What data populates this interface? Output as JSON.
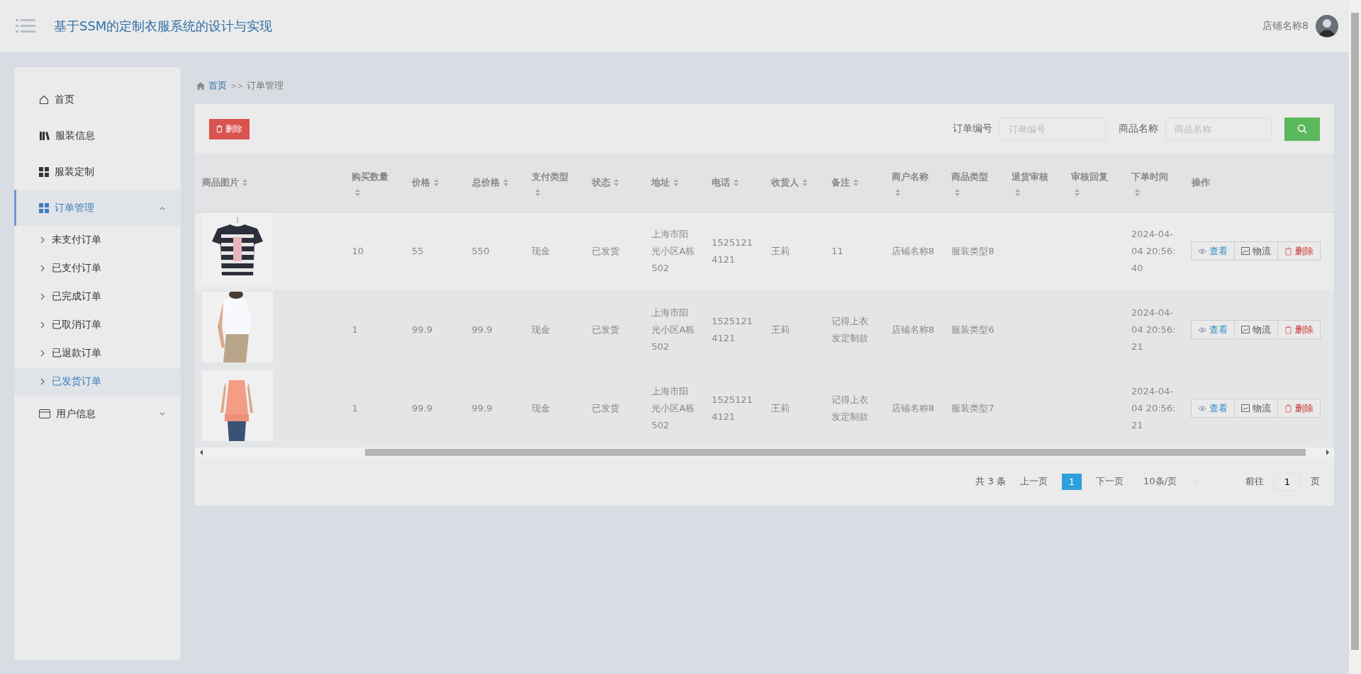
{
  "header": {
    "title": "基于SSM的定制衣服系统的设计与实现",
    "user": "店铺名称8"
  },
  "sidebar": {
    "items": [
      {
        "label": "首页",
        "selected": false
      },
      {
        "label": "服装信息",
        "selected": false
      },
      {
        "label": "服装定制",
        "selected": false
      },
      {
        "label": "订单管理",
        "expanded": true,
        "selected": true,
        "children": [
          {
            "label": "未支付订单",
            "selected": false
          },
          {
            "label": "已支付订单",
            "selected": false
          },
          {
            "label": "已完成订单",
            "selected": false
          },
          {
            "label": "已取消订单",
            "selected": false
          },
          {
            "label": "已退款订单",
            "selected": false
          },
          {
            "label": "已发货订单",
            "selected": true
          }
        ]
      },
      {
        "label": "用户信息",
        "expanded": false,
        "selected": false
      }
    ]
  },
  "breadcrumb": {
    "home": "首页",
    "separator": ">>",
    "current": "订单管理"
  },
  "toolbar": {
    "delete_button": "删除",
    "filters": [
      {
        "label": "订单编号",
        "placeholder": "订单编号"
      },
      {
        "label": "商品名称",
        "placeholder": "商品名称"
      }
    ]
  },
  "table": {
    "columns": [
      {
        "label": "商品图片",
        "sortable": true
      },
      {
        "label": "购买数量",
        "sortable": true
      },
      {
        "label": "价格",
        "sortable": true
      },
      {
        "label": "总价格",
        "sortable": true
      },
      {
        "label": "支付类型",
        "sortable": true
      },
      {
        "label": "状态",
        "sortable": true
      },
      {
        "label": "地址",
        "sortable": true
      },
      {
        "label": "电话",
        "sortable": true
      },
      {
        "label": "收货人",
        "sortable": true
      },
      {
        "label": "备注",
        "sortable": true
      },
      {
        "label": "商户名称",
        "sortable": true
      },
      {
        "label": "商品类型",
        "sortable": true
      },
      {
        "label": "退货审核",
        "sortable": true
      },
      {
        "label": "审核回复",
        "sortable": true
      },
      {
        "label": "下单时间",
        "sortable": true
      },
      {
        "label": "操作",
        "sortable": false
      }
    ],
    "rows": [
      {
        "cells": [
          {
            "kind": "picture"
          },
          "10",
          "55",
          "550",
          "现金",
          "已发货",
          "上海市阳光小区A栋502",
          "15251214121",
          "王莉",
          "11",
          "店铺名称8",
          "服装类型8",
          "",
          "",
          "2024-04-04 20:56:40",
          {
            "kind": "actions",
            "buttons": [
              {
                "kind": "view",
                "label": "查看"
              },
              {
                "kind": "logistics",
                "label": "物流"
              },
              {
                "kind": "delete",
                "label": "删除"
              }
            ]
          }
        ]
      },
      {
        "cells": [
          {
            "kind": "picture"
          },
          "1",
          "99.9",
          "99.9",
          "现金",
          "已发货",
          "上海市阳光小区A栋502",
          "15251214121",
          "王莉",
          "记得上衣发定制款",
          "店铺名称8",
          "服装类型6",
          "",
          "",
          "2024-04-04 20:56:21",
          {
            "kind": "actions",
            "buttons": [
              {
                "kind": "view",
                "label": "查看"
              },
              {
                "kind": "logistics",
                "label": "物流"
              },
              {
                "kind": "delete",
                "label": "删除"
              }
            ]
          }
        ]
      },
      {
        "cells": [
          {
            "kind": "picture"
          },
          "1",
          "99.9",
          "99.9",
          "现金",
          "已发货",
          "上海市阳光小区A栋502",
          "15251214121",
          "王莉",
          "记得上衣发定制款",
          "店铺名称8",
          "服装类型7",
          "",
          "",
          "2024-04-04 20:56:21",
          {
            "kind": "actions",
            "buttons": [
              {
                "kind": "view",
                "label": "查看"
              },
              {
                "kind": "logistics",
                "label": "物流"
              },
              {
                "kind": "delete",
                "label": "删除"
              }
            ]
          }
        ]
      }
    ]
  },
  "pagination": {
    "total": "共 3 条",
    "prev": "上一页",
    "pages": [
      {
        "label": "1",
        "selected": true
      }
    ],
    "next": "下一页",
    "page_size": "10条/页",
    "goto_label": "前往",
    "goto_value": "1",
    "page_unit": "页"
  }
}
